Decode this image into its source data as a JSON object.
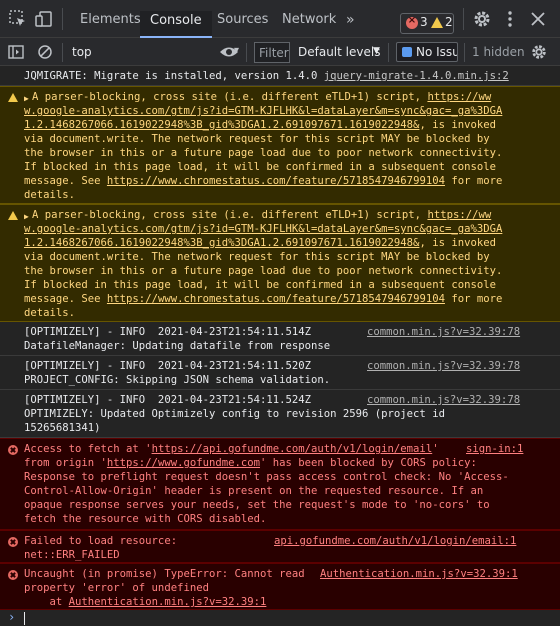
{
  "tabs": [
    {
      "label": "Elements"
    },
    {
      "label": "Console"
    },
    {
      "label": "Sources"
    },
    {
      "label": "Network"
    }
  ],
  "more_tabs_glyph": "»",
  "error_count": "3",
  "warning_count": "2",
  "context": "top",
  "filter_placeholder": "Filter",
  "levels_label": "Default levels",
  "issues_label": "No Issu",
  "hidden_label": "1 hidden",
  "messages": {
    "m0": {
      "line1_a": "JQMIGRATE: Migrate is installed, version 1.4.0 ",
      "src": "jquery-migrate-1.4.0.min.js:2"
    },
    "m1": {
      "l1a": "A parser-blocking, cross site (i.e. different eTLD+1) script, ",
      "l1b": "https://ww",
      "l2": "w.google-analytics.com/gtm/js?id=GTM-KJFLHK&l=dataLayer&m=sync&gac=_ga%3DGA",
      "l3a": "1.2.1468267066.1619022948%3B_gid%3DGA1.2.691097671.1619022948&",
      "l3b": ", is invoked",
      "l4": "via document.write. The network request for this script MAY be blocked by",
      "l5": "the browser in this or a future page load due to poor network connectivity.",
      "l6": "If blocked in this page load, it will be confirmed in a subsequent console",
      "l7a": "message. See ",
      "l7b": "https://www.chromestatus.com/feature/5718547946799104",
      "l7c": " for more",
      "l8": "details."
    },
    "m3": {
      "l1": "[OPTIMIZELY] - INFO  2021-04-23T21:54:11.514Z",
      "l2": "DatafileManager: Updating datafile from response",
      "src": "common.min.js?v=32.39:78"
    },
    "m4": {
      "l1": "[OPTIMIZELY] - INFO  2021-04-23T21:54:11.520Z",
      "l2": "PROJECT_CONFIG: Skipping JSON schema validation.",
      "src": "common.min.js?v=32.39:78"
    },
    "m5": {
      "l1": "[OPTIMIZELY] - INFO  2021-04-23T21:54:11.524Z",
      "l2": "OPTIMIZELY: Updated Optimizely config to revision 2596 (project id",
      "l3": "15265681341)",
      "src": "common.min.js?v=32.39:78"
    },
    "m6": {
      "l1a": "Access to fetch at '",
      "l1b": "https://api.gofundme.com/auth/v1/login/email",
      "l1c": "'",
      "src": "sign-in:1",
      "l2a": "from origin '",
      "l2b": "https://www.gofundme.com",
      "l2c": "' has been blocked by CORS policy:",
      "l3": "Response to preflight request doesn't pass access control check: No 'Access-",
      "l4": "Control-Allow-Origin' header is present on the requested resource. If an",
      "l5": "opaque response serves your needs, set the request's mode to 'no-cors' to",
      "l6": "fetch the resource with CORS disabled."
    },
    "m7": {
      "l1": "Failed to load resource:",
      "src": "api.gofundme.com/auth/v1/login/email:1",
      "l2": "net::ERR_FAILED"
    },
    "m8": {
      "l1": "Uncaught (in promise) TypeError: Cannot read",
      "src": "Authentication.min.js?v=32.39:1",
      "l2": "property 'error' of undefined",
      "l3a": "    at ",
      "l3b": "Authentication.min.js?v=32.39:1"
    }
  },
  "prompt_glyph": "›",
  "colors": {
    "accent": "#8ab4f8",
    "error": "#e46962",
    "warning": "#f2c94c",
    "background": "#242424"
  }
}
